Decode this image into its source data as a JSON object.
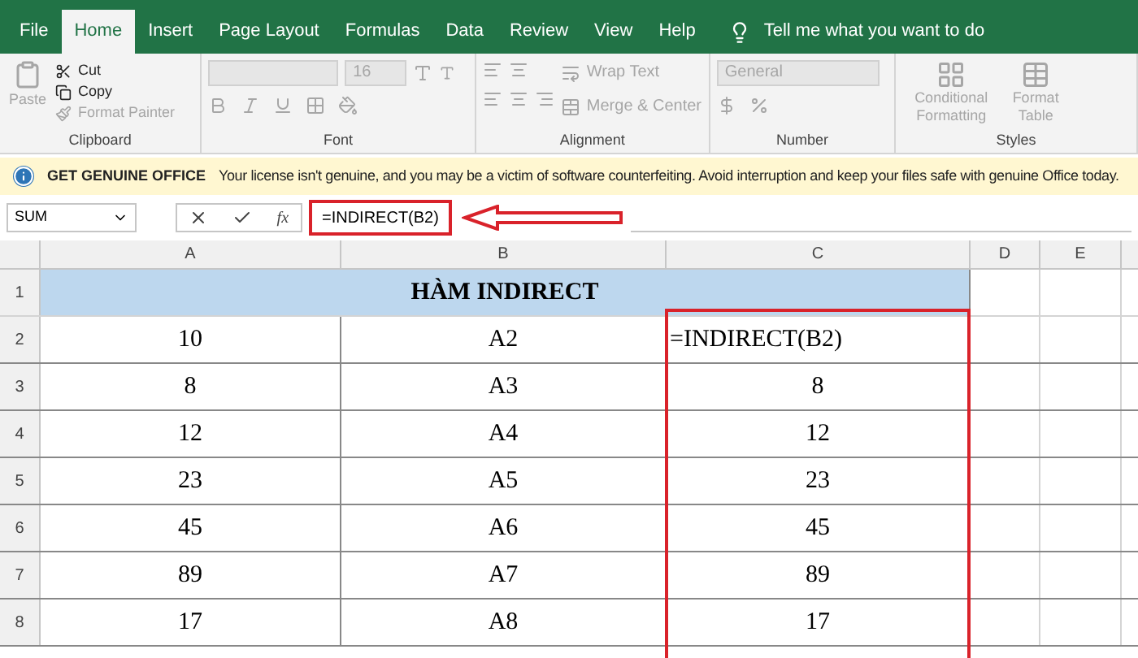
{
  "tabs": [
    {
      "label": "File",
      "selected": false
    },
    {
      "label": "Home",
      "selected": true
    },
    {
      "label": "Insert",
      "selected": false
    },
    {
      "label": "Page Layout",
      "selected": false
    },
    {
      "label": "Formulas",
      "selected": false
    },
    {
      "label": "Data",
      "selected": false
    },
    {
      "label": "Review",
      "selected": false
    },
    {
      "label": "View",
      "selected": false
    },
    {
      "label": "Help",
      "selected": false
    }
  ],
  "tell_me": "Tell me what you want to do",
  "clipboard": {
    "label": "Clipboard",
    "paste": {
      "label": "Paste",
      "disabled": true
    },
    "cut": {
      "label": "Cut",
      "disabled": false
    },
    "copy": {
      "label": "Copy",
      "disabled": false
    },
    "format_painter": {
      "label": "Format Painter",
      "disabled": true
    }
  },
  "font": {
    "label": "Font",
    "font_size": "16"
  },
  "alignment": {
    "label": "Alignment",
    "wrap_text": "Wrap Text",
    "merge_center": "Merge & Center"
  },
  "number": {
    "label": "Number",
    "format": "General"
  },
  "styles": {
    "label": "Styles",
    "conditional_formatting": "Conditional Formatting",
    "format_table_1": "Format",
    "format_table_2": "Table"
  },
  "message_bar": {
    "title": "GET GENUINE OFFICE",
    "text": "Your license isn't genuine, and you may be a victim of software counterfeiting. Avoid interruption and keep your files safe with genuine Office today."
  },
  "formula_bar": {
    "name_box": "SUM",
    "function_label": "fx",
    "formula": "=INDIRECT(B2)"
  },
  "sheet": {
    "columns": [
      "A",
      "B",
      "C",
      "D",
      "E"
    ],
    "title_row": {
      "number": "1",
      "title": "HÀM INDIRECT"
    },
    "rows": [
      {
        "number": "2",
        "cells": [
          {
            "text": "10",
            "kind": "value"
          },
          {
            "text": "A2",
            "kind": "value"
          },
          {
            "text": "=INDIRECT(B2)",
            "kind": "formula"
          }
        ]
      },
      {
        "number": "3",
        "cells": [
          {
            "text": "8",
            "kind": "value"
          },
          {
            "text": "A3",
            "kind": "value"
          },
          {
            "text": "8",
            "kind": "value"
          }
        ]
      },
      {
        "number": "4",
        "cells": [
          {
            "text": "12",
            "kind": "value"
          },
          {
            "text": "A4",
            "kind": "value"
          },
          {
            "text": "12",
            "kind": "value"
          }
        ]
      },
      {
        "number": "5",
        "cells": [
          {
            "text": "23",
            "kind": "value"
          },
          {
            "text": "A5",
            "kind": "value"
          },
          {
            "text": "23",
            "kind": "value"
          }
        ]
      },
      {
        "number": "6",
        "cells": [
          {
            "text": "45",
            "kind": "value"
          },
          {
            "text": "A6",
            "kind": "value"
          },
          {
            "text": "45",
            "kind": "value"
          }
        ]
      },
      {
        "number": "7",
        "cells": [
          {
            "text": "89",
            "kind": "value"
          },
          {
            "text": "A7",
            "kind": "value"
          },
          {
            "text": "89",
            "kind": "value"
          }
        ]
      },
      {
        "number": "8",
        "cells": [
          {
            "text": "17",
            "kind": "value"
          },
          {
            "text": "A8",
            "kind": "value"
          },
          {
            "text": "17",
            "kind": "value"
          }
        ]
      }
    ]
  }
}
